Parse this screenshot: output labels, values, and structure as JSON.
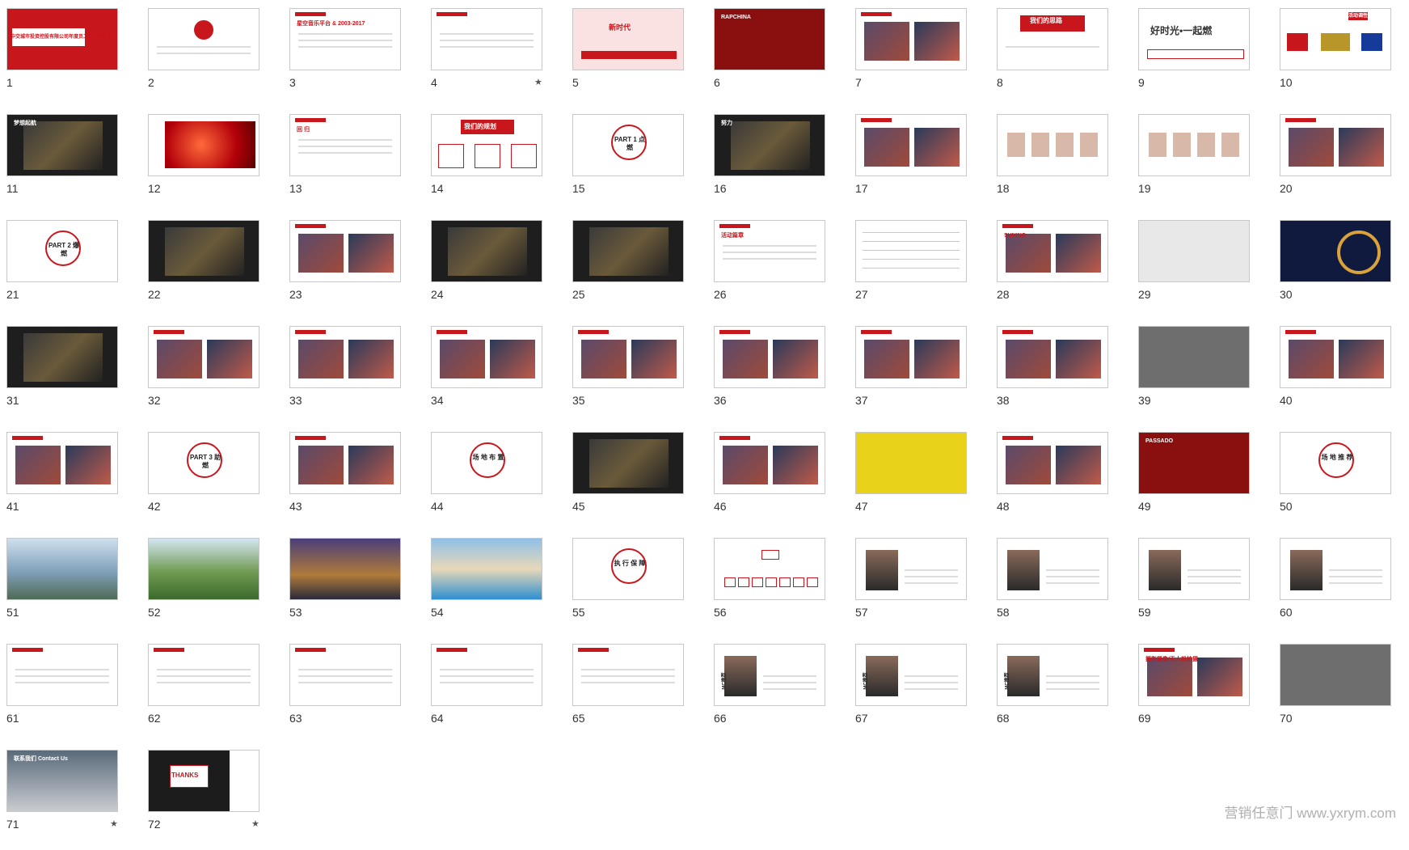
{
  "slides": [
    {
      "n": "1",
      "s": "red-title",
      "t": "中交城市投资控股有限公司年度员工联欢会策划方案"
    },
    {
      "n": "2",
      "s": "quote",
      "t": ""
    },
    {
      "n": "3",
      "s": "white",
      "t": "星空音乐平台 & 2003-2017"
    },
    {
      "n": "4",
      "s": "white",
      "t": "",
      "star": true
    },
    {
      "n": "5",
      "s": "pink",
      "t": "新时代"
    },
    {
      "n": "6",
      "s": "photo-red",
      "t": "RAPCHINA"
    },
    {
      "n": "7",
      "s": "photos",
      "t": ""
    },
    {
      "n": "8",
      "s": "idea",
      "t": "我们的思路"
    },
    {
      "n": "9",
      "s": "theme",
      "t": "好时光•一起燃"
    },
    {
      "n": "10",
      "s": "colors",
      "t": "活动调性"
    },
    {
      "n": "11",
      "s": "dark",
      "t": "梦想起航"
    },
    {
      "n": "12",
      "s": "redstage",
      "t": ""
    },
    {
      "n": "13",
      "s": "white",
      "t": "回 归"
    },
    {
      "n": "14",
      "s": "plan",
      "t": "我们的规划"
    },
    {
      "n": "15",
      "s": "circle",
      "t": "PART 1 点燃"
    },
    {
      "n": "16",
      "s": "photo-dark",
      "t": "努力"
    },
    {
      "n": "17",
      "s": "photos",
      "t": ""
    },
    {
      "n": "18",
      "s": "faces",
      "t": ""
    },
    {
      "n": "19",
      "s": "faces",
      "t": ""
    },
    {
      "n": "20",
      "s": "photos",
      "t": ""
    },
    {
      "n": "21",
      "s": "circle",
      "t": "PART 2 爆燃"
    },
    {
      "n": "22",
      "s": "dark",
      "t": ""
    },
    {
      "n": "23",
      "s": "photos",
      "t": ""
    },
    {
      "n": "24",
      "s": "dark",
      "t": ""
    },
    {
      "n": "25",
      "s": "dark",
      "t": ""
    },
    {
      "n": "26",
      "s": "white",
      "t": "活动篇章"
    },
    {
      "n": "27",
      "s": "table",
      "t": ""
    },
    {
      "n": "28",
      "s": "photos",
      "t": "SUNING"
    },
    {
      "n": "29",
      "s": "photo-light",
      "t": ""
    },
    {
      "n": "30",
      "s": "navy",
      "t": ""
    },
    {
      "n": "31",
      "s": "dark",
      "t": ""
    },
    {
      "n": "32",
      "s": "photos",
      "t": ""
    },
    {
      "n": "33",
      "s": "photos",
      "t": ""
    },
    {
      "n": "34",
      "s": "photos",
      "t": ""
    },
    {
      "n": "35",
      "s": "photos",
      "t": ""
    },
    {
      "n": "36",
      "s": "photos",
      "t": ""
    },
    {
      "n": "37",
      "s": "photos",
      "t": ""
    },
    {
      "n": "38",
      "s": "photos",
      "t": ""
    },
    {
      "n": "39",
      "s": "gray",
      "t": ""
    },
    {
      "n": "40",
      "s": "photos",
      "t": ""
    },
    {
      "n": "41",
      "s": "photos",
      "t": ""
    },
    {
      "n": "42",
      "s": "circle",
      "t": "PART 3 助燃"
    },
    {
      "n": "43",
      "s": "photos",
      "t": ""
    },
    {
      "n": "44",
      "s": "circle",
      "t": "场 地 布 置"
    },
    {
      "n": "45",
      "s": "photo-dark",
      "t": ""
    },
    {
      "n": "46",
      "s": "photos",
      "t": ""
    },
    {
      "n": "47",
      "s": "photo-yellow",
      "t": ""
    },
    {
      "n": "48",
      "s": "photos",
      "t": ""
    },
    {
      "n": "49",
      "s": "photo-red",
      "t": "PASSADO"
    },
    {
      "n": "50",
      "s": "circle",
      "t": "场 地 推 荐"
    },
    {
      "n": "51",
      "s": "photo-city",
      "t": ""
    },
    {
      "n": "52",
      "s": "photo-green",
      "t": ""
    },
    {
      "n": "53",
      "s": "photo-hotel",
      "t": ""
    },
    {
      "n": "54",
      "s": "photo-pool",
      "t": ""
    },
    {
      "n": "55",
      "s": "circle",
      "t": "执 行 保 障"
    },
    {
      "n": "56",
      "s": "org",
      "t": ""
    },
    {
      "n": "57",
      "s": "profile",
      "t": ""
    },
    {
      "n": "58",
      "s": "profile",
      "t": ""
    },
    {
      "n": "59",
      "s": "profile",
      "t": ""
    },
    {
      "n": "60",
      "s": "profile",
      "t": ""
    },
    {
      "n": "61",
      "s": "white",
      "t": ""
    },
    {
      "n": "62",
      "s": "white",
      "t": ""
    },
    {
      "n": "63",
      "s": "white",
      "t": ""
    },
    {
      "n": "64",
      "s": "white",
      "t": ""
    },
    {
      "n": "65",
      "s": "white",
      "t": ""
    },
    {
      "n": "66",
      "s": "mc",
      "t": "MC推荐"
    },
    {
      "n": "67",
      "s": "mc",
      "t": "MC推荐"
    },
    {
      "n": "68",
      "s": "mc",
      "t": "MC推荐"
    },
    {
      "n": "69",
      "s": "photos",
      "t": "摄影摄像/无人机拍摄"
    },
    {
      "n": "70",
      "s": "gray",
      "t": ""
    },
    {
      "n": "71",
      "s": "photo-map",
      "t": "联系我们 Contact Us",
      "star": true
    },
    {
      "n": "72",
      "s": "thanks",
      "t": "THANKS",
      "star": true
    }
  ],
  "star_glyph": "★",
  "watermark": "营销任意门 www.yxrym.com"
}
